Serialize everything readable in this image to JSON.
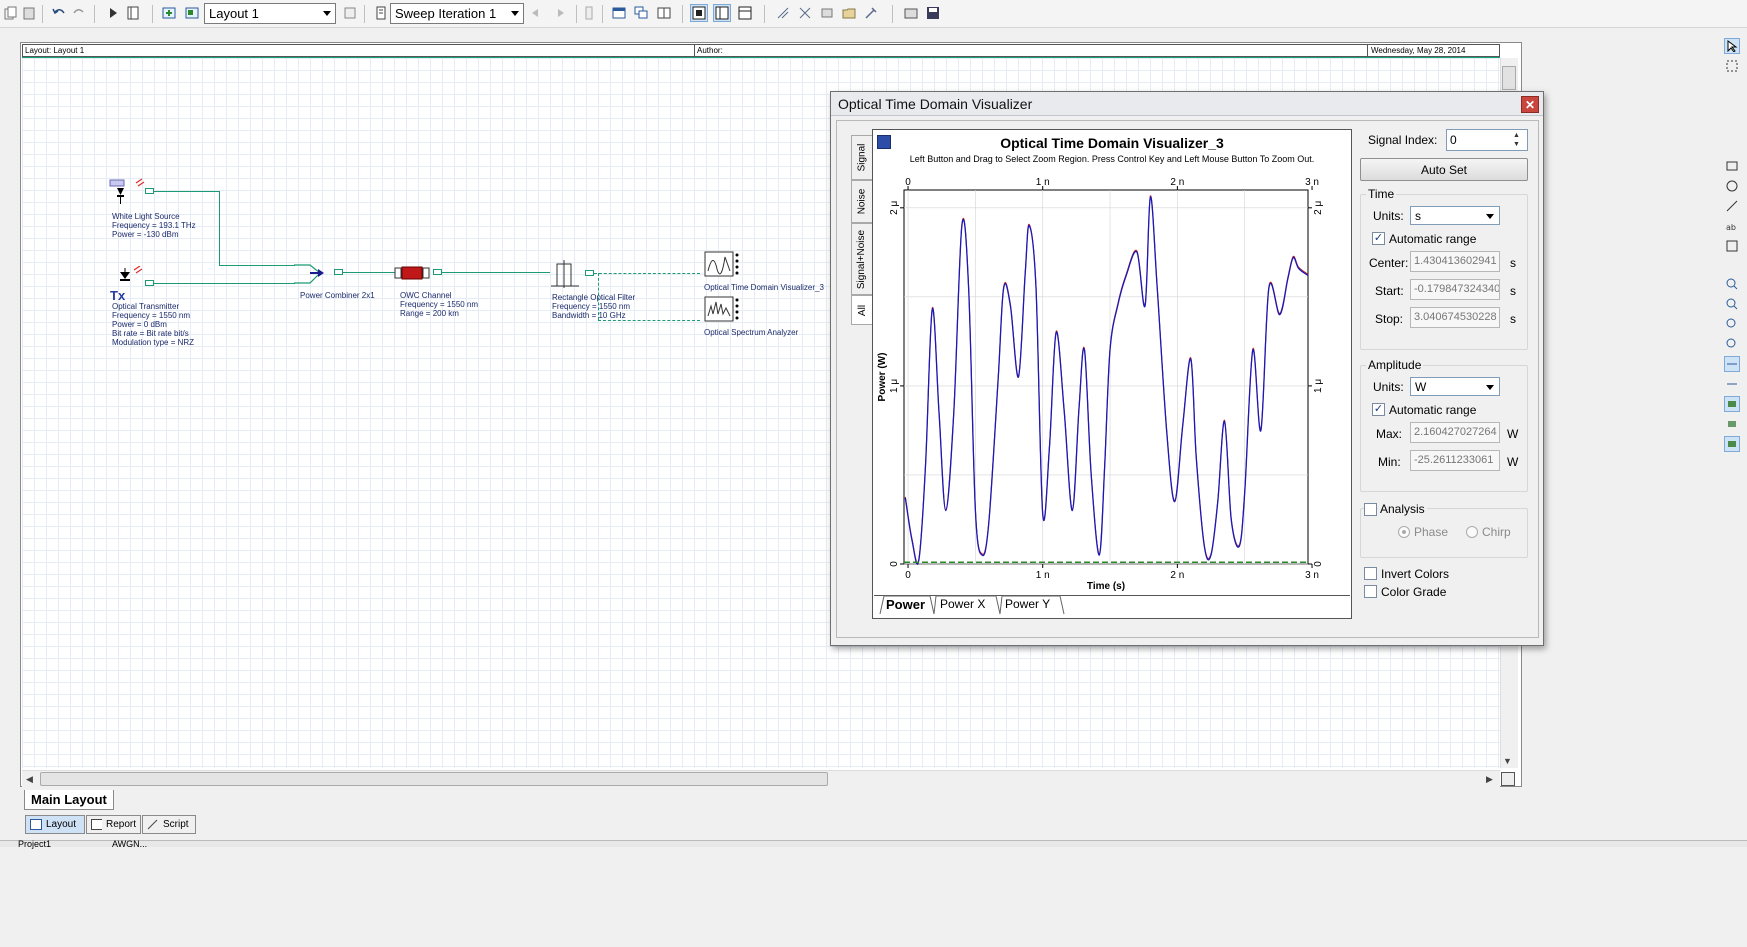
{
  "toolbar": {
    "layout_combo": "Layout 1",
    "sweep_combo": "Sweep Iteration 1"
  },
  "layout_header": {
    "layout": "Layout: Layout 1",
    "author": "Author:",
    "date": "Wednesday, May 28, 2014"
  },
  "components": {
    "white_light": {
      "title": "White Light Source",
      "line1": "Frequency = 193.1  THz",
      "line2": "Power = -130  dBm"
    },
    "transmitter": {
      "symbol": "Tx",
      "title": "Optical Transmitter",
      "line1": "Frequency = 1550  nm",
      "line2": "Power = 0  dBm",
      "line3": "Bit rate = Bit rate  bit/s",
      "line4": "Modulation type = NRZ"
    },
    "combiner": {
      "title": "Power Combiner 2x1"
    },
    "owc": {
      "title": "OWC Channel",
      "line1": "Frequency = 1550  nm",
      "line2": "Range = 200  km"
    },
    "filter": {
      "title": "Rectangle Optical Filter",
      "line1": "Frequency = 1550  nm",
      "line2": "Bandwidth = 10  GHz"
    },
    "otdv": {
      "title": "Optical Time Domain Visualizer_3"
    },
    "osa": {
      "title": "Optical Spectrum Analyzer"
    }
  },
  "bottom": {
    "main_tab": "Main Layout",
    "tabs": [
      "Layout",
      "Report",
      "Script"
    ],
    "status_items": [
      "Project1",
      "AWGN..."
    ]
  },
  "visualizer": {
    "window_title": "Optical Time Domain Visualizer",
    "close": "✕",
    "vertical_tabs": [
      "Signal",
      "Noise",
      "Signal+Noise",
      "All"
    ],
    "plot_title": "Optical Time Domain Visualizer_3",
    "plot_subtitle": "Left Button and Drag to Select Zoom Region. Press Control Key and Left Mouse Button To Zoom Out.",
    "plot_tabs": [
      "Power",
      "Power X",
      "Power Y"
    ],
    "settings": {
      "signal_index_label": "Signal Index:",
      "signal_index": "0",
      "auto_set": "Auto Set",
      "time_group": "Time",
      "units_label": "Units:",
      "time_units": "s",
      "automatic_range": "Automatic range",
      "center_label": "Center:",
      "center": "1.430413602941",
      "start_label": "Start:",
      "start": "-0.179847324340",
      "stop_label": "Stop:",
      "stop": "3.040674530228",
      "unit_s": "s",
      "amplitude_group": "Amplitude",
      "amp_units": "W",
      "max_label": "Max:",
      "max": "2.160427027264",
      "min_label": "Min:",
      "min": "-25.2611233061",
      "unit_w": "W",
      "analysis": "Analysis",
      "phase": "Phase",
      "chirp": "Chirp",
      "invert_colors": "Invert Colors",
      "color_grade": "Color Grade"
    }
  },
  "chart_data": {
    "type": "line",
    "title": "Optical Time Domain Visualizer_3",
    "xlabel": "Time (s)",
    "ylabel": "Power (W)",
    "x_ticks": [
      "0",
      "1 n",
      "2 n",
      "3 n"
    ],
    "y_ticks": [
      "0",
      "1 μ",
      "2 μ"
    ],
    "xlim": [
      -0.03,
      2.97
    ],
    "ylim": [
      0,
      2.1
    ],
    "x_unit": "ns",
    "y_unit": "μW",
    "grid": true,
    "colors": {
      "signal": "#1a1ab8",
      "signal_overlay": "#c02020",
      "noise": "#2a8a2a"
    },
    "series": [
      {
        "color": "#1a1ab8",
        "x": [
          -0.02,
          0.03,
          0.08,
          0.13,
          0.18,
          0.23,
          0.28,
          0.34,
          0.4,
          0.45,
          0.5,
          0.55,
          0.6,
          0.67,
          0.71,
          0.76,
          0.82,
          0.87,
          0.9,
          0.95,
          1.0,
          1.05,
          1.1,
          1.16,
          1.22,
          1.27,
          1.31,
          1.36,
          1.42,
          1.46,
          1.5,
          1.56,
          1.62,
          1.7,
          1.76,
          1.8,
          1.85,
          1.92,
          1.98,
          2.04,
          2.1,
          2.14,
          2.2,
          2.25,
          2.3,
          2.35,
          2.4,
          2.46,
          2.5,
          2.56,
          2.62,
          2.68,
          2.76,
          2.82,
          2.86,
          2.9,
          2.97
        ],
        "y": [
          0.37,
          0.13,
          0.02,
          0.55,
          1.43,
          0.85,
          0.3,
          0.85,
          1.9,
          1.55,
          0.3,
          0.05,
          0.23,
          1.05,
          1.55,
          1.45,
          1.05,
          1.63,
          1.9,
          1.55,
          0.28,
          0.65,
          1.3,
          0.85,
          0.3,
          0.88,
          1.2,
          0.5,
          0.05,
          0.55,
          1.2,
          1.46,
          1.62,
          1.75,
          1.45,
          2.06,
          1.55,
          0.75,
          0.35,
          0.78,
          1.15,
          0.6,
          0.1,
          0.05,
          0.35,
          0.8,
          0.25,
          0.1,
          0.4,
          1.2,
          0.75,
          1.55,
          1.4,
          1.6,
          1.72,
          1.66,
          1.62
        ]
      },
      {
        "color": "#2a8a2a",
        "x": [
          -0.03,
          2.97
        ],
        "y": [
          0.01,
          0.01
        ]
      }
    ]
  }
}
